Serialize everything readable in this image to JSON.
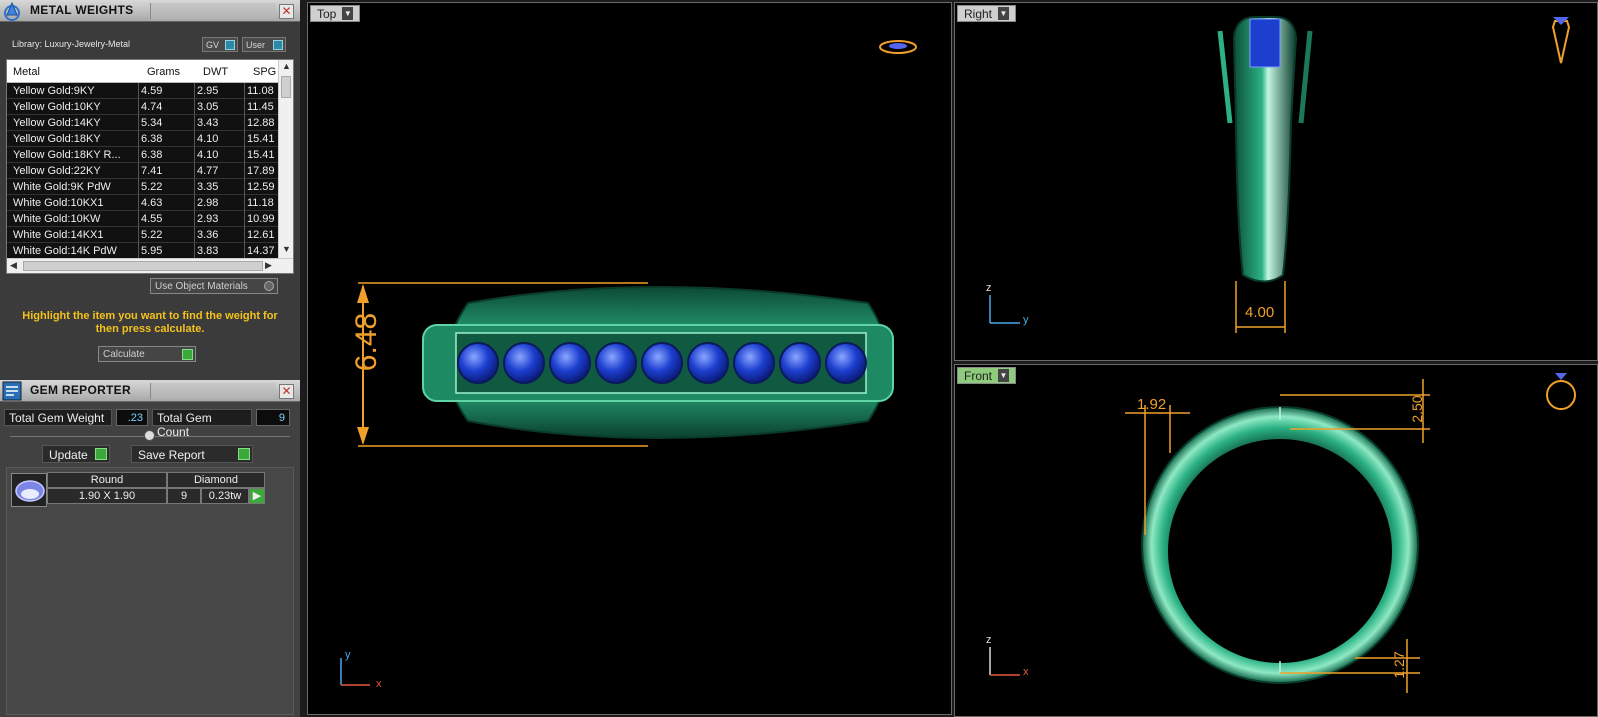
{
  "metal_weights": {
    "title": "METAL WEIGHTS",
    "library_label": "Library: Luxury-Jewelry-Metal",
    "toggle_gv": "GV",
    "toggle_user": "User",
    "columns": [
      "Metal",
      "Grams",
      "DWT",
      "SPG"
    ],
    "rows": [
      [
        "Yellow Gold:9KY",
        "4.59",
        "2.95",
        "11.08"
      ],
      [
        "Yellow Gold:10KY",
        "4.74",
        "3.05",
        "11.45"
      ],
      [
        "Yellow Gold:14KY",
        "5.34",
        "3.43",
        "12.88"
      ],
      [
        "Yellow Gold:18KY",
        "6.38",
        "4.10",
        "15.41"
      ],
      [
        "Yellow Gold:18KY R...",
        "6.38",
        "4.10",
        "15.41"
      ],
      [
        "Yellow Gold:22KY",
        "7.41",
        "4.77",
        "17.89"
      ],
      [
        "White Gold:9K PdW",
        "5.22",
        "3.35",
        "12.59"
      ],
      [
        "White Gold:10KX1",
        "4.63",
        "2.98",
        "11.18"
      ],
      [
        "White Gold:10KW",
        "4.55",
        "2.93",
        "10.99"
      ],
      [
        "White Gold:14KX1",
        "5.22",
        "3.36",
        "12.61"
      ],
      [
        "White Gold:14K PdW",
        "5.95",
        "3.83",
        "14.37"
      ]
    ],
    "use_object_materials": "Use Object Materials",
    "hint": "Highlight the item you want to find the weight for then press calculate.",
    "calculate": "Calculate"
  },
  "gem_reporter": {
    "title": "GEM REPORTER",
    "total_weight_label": "Total Gem Weight",
    "total_weight_value": ".23",
    "total_count_label": "Total Gem Count",
    "total_count_value": "9",
    "update": "Update",
    "save_report": "Save Report",
    "gem": {
      "shape": "Round",
      "size": "1.90 X 1.90",
      "type": "Diamond",
      "count": "9",
      "weight": "0.23tw"
    }
  },
  "viewports": {
    "top": {
      "label": "Top",
      "dimension": "6.48"
    },
    "right": {
      "label": "Right",
      "dimension": "4.00"
    },
    "front": {
      "label": "Front",
      "dim_left": "1.92",
      "dim_top": "2.50",
      "dim_bottom": "1.27"
    }
  },
  "axes": {
    "x": "x",
    "y": "y",
    "z": "z"
  },
  "colors": {
    "dimension": "#f0a02a",
    "ring_green": "#1f9a6a",
    "gem_blue": "#1d3fd0",
    "hint_yellow": "#f3c21c"
  }
}
